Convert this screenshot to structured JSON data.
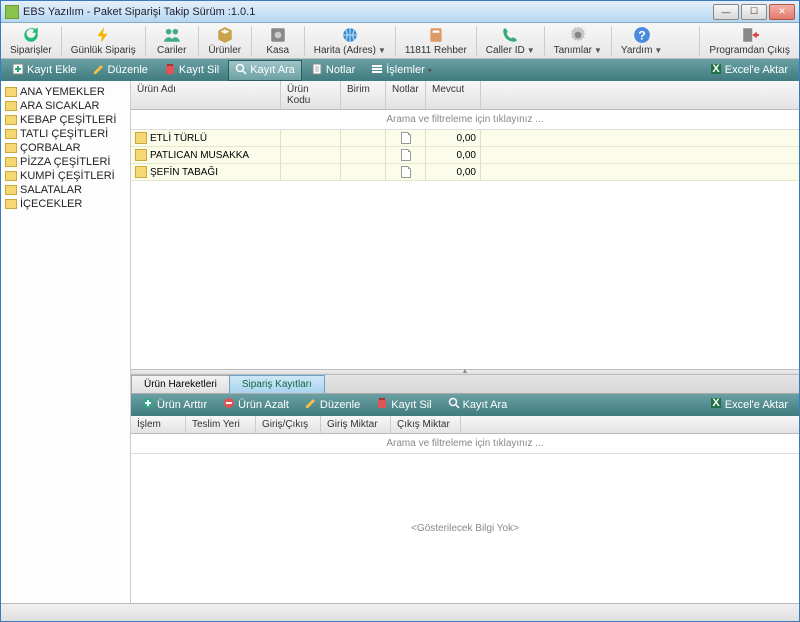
{
  "window": {
    "title": "EBS Yazılım - Paket Siparişi Takip Sürüm :1.0.1"
  },
  "toolbar": [
    {
      "label": "Siparişler",
      "icon": "refresh-icon",
      "drop": false
    },
    {
      "label": "Günlük Sipariş",
      "icon": "bolt-icon",
      "drop": false
    },
    {
      "label": "Cariler",
      "icon": "people-icon",
      "drop": false
    },
    {
      "label": "Ürünler",
      "icon": "cube-icon",
      "drop": false
    },
    {
      "label": "Kasa",
      "icon": "safe-icon",
      "drop": false
    },
    {
      "label": "Harita (Adres)",
      "icon": "globe-icon",
      "drop": true
    },
    {
      "label": "11811 Rehber",
      "icon": "phonebook-icon",
      "drop": false
    },
    {
      "label": "Caller ID",
      "icon": "phone-icon",
      "drop": true
    },
    {
      "label": "Tanımlar",
      "icon": "gear-icon",
      "drop": true
    },
    {
      "label": "Yardım",
      "icon": "help-icon",
      "drop": true
    }
  ],
  "toolbar_right": {
    "label": "Programdan Çıkış",
    "icon": "exit-icon"
  },
  "subbar_top": {
    "buttons": [
      {
        "label": "Kayıt Ekle",
        "icon": "add-icon"
      },
      {
        "label": "Düzenle",
        "icon": "edit-icon"
      },
      {
        "label": "Kayıt Sil",
        "icon": "delete-icon"
      },
      {
        "label": "Kayıt Ara",
        "icon": "search-icon",
        "active": true
      },
      {
        "label": "Notlar",
        "icon": "note-icon"
      },
      {
        "label": "İşlemler",
        "icon": "actions-icon",
        "drop": true
      }
    ],
    "right": {
      "label": "Excel'e Aktar",
      "icon": "excel-icon"
    }
  },
  "tree": [
    "ANA YEMEKLER",
    "ARA SICAKLAR",
    "KEBAP ÇEŞİTLERİ",
    "TATLI ÇEŞİTLERİ",
    "ÇORBALAR",
    "PİZZA ÇEŞİTLERİ",
    "KUMPİ ÇEŞİTLERİ",
    "SALATALAR",
    "İÇECEKLER"
  ],
  "top_grid": {
    "cols": [
      "Ürün Adı",
      "Ürün Kodu",
      "Birim",
      "Notlar",
      "Mevcut"
    ],
    "filter_hint": "Arama ve filtreleme  için tıklayınız ...",
    "rows": [
      {
        "name": "ETLİ TÜRLÜ",
        "code": "",
        "unit": "",
        "notes_icon": true,
        "stock": "0,00"
      },
      {
        "name": "PATLICAN MUSAKKA",
        "code": "",
        "unit": "",
        "notes_icon": true,
        "stock": "0,00"
      },
      {
        "name": "ŞEFİN TABAĞI",
        "code": "",
        "unit": "",
        "notes_icon": true,
        "stock": "0,00"
      }
    ]
  },
  "tabs": [
    {
      "label": "Ürün Hareketleri",
      "active": false
    },
    {
      "label": "Sipariş Kayıtları",
      "active": true
    }
  ],
  "subbar_bottom": {
    "buttons": [
      {
        "label": "Ürün Arttır",
        "icon": "plus-icon"
      },
      {
        "label": "Ürün Azalt",
        "icon": "minus-icon"
      },
      {
        "label": "Düzenle",
        "icon": "edit-icon"
      },
      {
        "label": "Kayıt Sil",
        "icon": "delete-icon"
      },
      {
        "label": "Kayıt Ara",
        "icon": "search-icon"
      }
    ],
    "right": {
      "label": "Excel'e Aktar",
      "icon": "excel-icon"
    }
  },
  "bottom_grid": {
    "cols": [
      "İşlem",
      "Teslim Yeri",
      "Giriş/Çıkış",
      "Giriş Miktar",
      "Çıkış Miktar"
    ],
    "filter_hint": "Arama ve filtreleme  için tıklayınız ...",
    "empty": "<Gösterilecek Bilgi Yok>"
  }
}
